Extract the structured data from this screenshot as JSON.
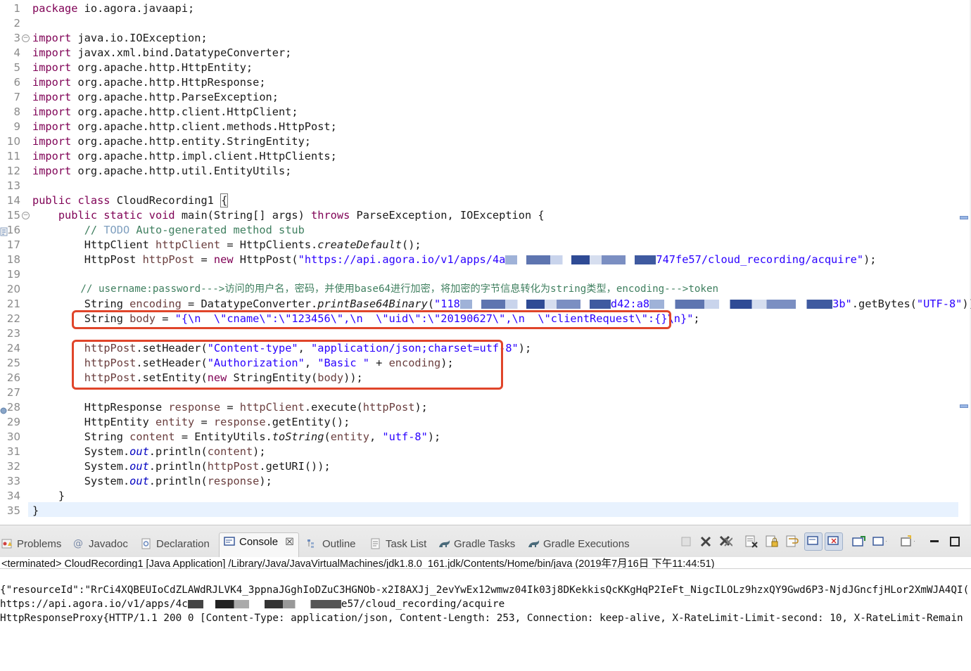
{
  "editor": {
    "lines": [
      {
        "n": "1"
      },
      {
        "n": "2"
      },
      {
        "n": "3"
      },
      {
        "n": "4"
      },
      {
        "n": "5"
      },
      {
        "n": "6"
      },
      {
        "n": "7"
      },
      {
        "n": "8"
      },
      {
        "n": "9"
      },
      {
        "n": "10"
      },
      {
        "n": "11"
      },
      {
        "n": "12"
      },
      {
        "n": "13"
      },
      {
        "n": "14"
      },
      {
        "n": "15"
      },
      {
        "n": "16"
      },
      {
        "n": "17"
      },
      {
        "n": "18"
      },
      {
        "n": "19"
      },
      {
        "n": "20"
      },
      {
        "n": "21"
      },
      {
        "n": "22"
      },
      {
        "n": "23"
      },
      {
        "n": "24"
      },
      {
        "n": "25"
      },
      {
        "n": "26"
      },
      {
        "n": "27"
      },
      {
        "n": "28"
      },
      {
        "n": "29"
      },
      {
        "n": "30"
      },
      {
        "n": "31"
      },
      {
        "n": "32"
      },
      {
        "n": "33"
      },
      {
        "n": "34"
      },
      {
        "n": "35"
      }
    ],
    "kw_package": "package",
    "pkg": " io.agora.javaapi;",
    "kw_import": "import",
    "imports": [
      " java.io.IOException;",
      " javax.xml.bind.DatatypeConverter;",
      " org.apache.http.HttpEntity;",
      " org.apache.http.HttpResponse;",
      " org.apache.http.ParseException;",
      " org.apache.http.client.HttpClient;",
      " org.apache.http.client.methods.HttpPost;",
      " org.apache.http.entity.StringEntity;",
      " org.apache.http.impl.client.HttpClients;",
      " org.apache.http.util.EntityUtils;"
    ],
    "kw_public_class": "public class",
    "class_name": " CloudRecording1 ",
    "brace_open": "{",
    "kw_public_static_void": "public static void",
    "main_sig_a": " main(String[] args) ",
    "kw_throws": "throws",
    "main_sig_b": " ParseException, IOException {",
    "c16_a": "// ",
    "c16_todo": "TODO",
    "c16_b": " Auto-generated method stub",
    "l17_a": "HttpClient ",
    "l17_var": "httpClient",
    "l17_b": " = HttpClients.",
    "l17_m": "createDefault",
    "l17_c": "();",
    "l18_a": "HttpPost ",
    "l18_var": "httpPost",
    "l18_b": " = ",
    "l18_new": "new",
    "l18_c": " HttpPost(",
    "l18_s1": "\"https://api.agora.io/v1/apps/4a",
    "l18_s2": "747fe57/cloud_recording/acquire\"",
    "l18_d": ");",
    "l20": "// username:password--->访问的用户名，密码，并使用base64进行加密，将加密的字节信息转化为string类型，encoding--->token",
    "l21_a": "String ",
    "l21_var": "encoding",
    "l21_b": " = DatatypeConverter.",
    "l21_m": "printBase64Binary",
    "l21_c": "(",
    "l21_s1": "\"118",
    "l21_s2": "d42:a8",
    "l21_s3": "3b\"",
    "l21_d": ".getBytes(",
    "l21_s4": "\"UTF-8\"",
    "l21_e": "));",
    "l22_a": "String ",
    "l22_var": "body",
    "l22_b": " = ",
    "l22_s": "\"{\\n  \\\"cname\\\":\\\"123456\\\",\\n  \\\"uid\\\":\\\"20190627\\\",\\n  \\\"clientRequest\\\":{}\\n}\"",
    "l22_c": ";",
    "l24_a": "httpPost",
    "l24_b": ".setHeader(",
    "l24_s1": "\"Content-type\"",
    "l24_c": ", ",
    "l24_s2": "\"application/json;charset=utf-8\"",
    "l24_d": ");",
    "l25_a": "httpPost",
    "l25_b": ".setHeader(",
    "l25_s1": "\"Authorization\"",
    "l25_c": ", ",
    "l25_s2": "\"Basic \"",
    "l25_d": " + ",
    "l25_var": "encoding",
    "l25_e": ");",
    "l26_a": "httpPost",
    "l26_b": ".setEntity(",
    "l26_new": "new",
    "l26_c": " StringEntity(",
    "l26_var": "body",
    "l26_d": "));",
    "l28_a": "HttpResponse ",
    "l28_var": "response",
    "l28_b": " = ",
    "l28_v2": "httpClient",
    "l28_c": ".execute(",
    "l28_v3": "httpPost",
    "l28_d": ");",
    "l29_a": "HttpEntity ",
    "l29_var": "entity",
    "l29_b": " = ",
    "l29_v2": "response",
    "l29_c": ".getEntity();",
    "l30_a": "String ",
    "l30_var": "content",
    "l30_b": " = EntityUtils.",
    "l30_m": "toString",
    "l30_c": "(",
    "l30_v2": "entity",
    "l30_d": ", ",
    "l30_s": "\"utf-8\"",
    "l30_e": ");",
    "sys": "System.",
    "out": "out",
    "l31_a": ".println(",
    "l31_v": "content",
    "l31_b": ");",
    "l32_a": ".println(",
    "l32_v": "httpPost",
    "l32_b": ".getURI());",
    "l33_a": ".println(",
    "l33_v": "response",
    "l33_b": ");",
    "l34": "}",
    "l35": "}"
  },
  "views": {
    "tabs": [
      {
        "label": "Problems",
        "icon": "problems-icon"
      },
      {
        "label": "Javadoc",
        "icon": "javadoc-icon"
      },
      {
        "label": "Declaration",
        "icon": "declaration-icon"
      },
      {
        "label": "Console",
        "icon": "console-icon",
        "active": true
      },
      {
        "label": "Outline",
        "icon": "outline-icon"
      },
      {
        "label": "Task List",
        "icon": "task-list-icon"
      },
      {
        "label": "Gradle Tasks",
        "icon": "gradle-tasks-icon"
      },
      {
        "label": "Gradle Executions",
        "icon": "gradle-executions-icon"
      }
    ],
    "close_glyph": "☒"
  },
  "console": {
    "terminated": "<terminated> CloudRecording1 [Java Application] /Library/Java/JavaVirtualMachines/jdk1.8.0_161.jdk/Contents/Home/bin/java (2019年7月16日 下午11:44:51)",
    "out1": "{\"resourceId\":\"RrCi4XQBEUIoCdZLAWdRJLVK4_3ppnaJGghIoDZuC3HGNOb-x2I8AXJj_2evYwEx12wmwz04Ik03j8DKekkisQcKKgHqP2IeFt_NigcILOLz9hzxQY9Gwd6P3-NjdJGncfjHLor2XmWJA4QI(",
    "out2_a": "https://api.agora.io/v1/apps/4c",
    "out2_b": "e57/cloud_recording/acquire",
    "out3": "HttpResponseProxy{HTTP/1.1 200 0 [Content-Type: application/json, Content-Length: 253, Connection: keep-alive, X-RateLimit-Limit-second: 10, X-RateLimit-Remain"
  },
  "colors": {
    "keyword": "#7f0055",
    "string": "#2a00ff",
    "comment": "#3f7f5f",
    "highlight_box": "#e0452a"
  }
}
